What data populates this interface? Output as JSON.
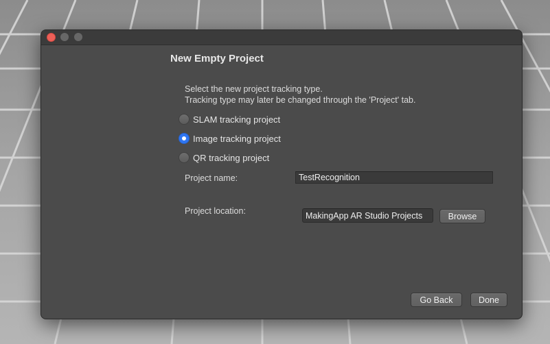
{
  "dialog": {
    "title": "New Empty Project",
    "description_line1": "Select the new project tracking type.",
    "description_line2": "Tracking type may later be changed through the 'Project' tab.",
    "tracking_options": [
      {
        "label": "SLAM tracking project",
        "selected": false
      },
      {
        "label": "Image tracking project",
        "selected": true
      },
      {
        "label": "QR tracking project",
        "selected": false
      }
    ],
    "project_name": {
      "label": "Project name:",
      "value": "TestRecognition"
    },
    "project_location": {
      "label": "Project location:",
      "value": "MakingApp AR Studio Projects"
    },
    "buttons": {
      "browse": "Browse",
      "go_back": "Go Back",
      "done": "Done"
    }
  },
  "colors": {
    "dialog_background": "#4b4b4b",
    "accent": "#2f76f2",
    "close_button": "#ed5f57"
  }
}
